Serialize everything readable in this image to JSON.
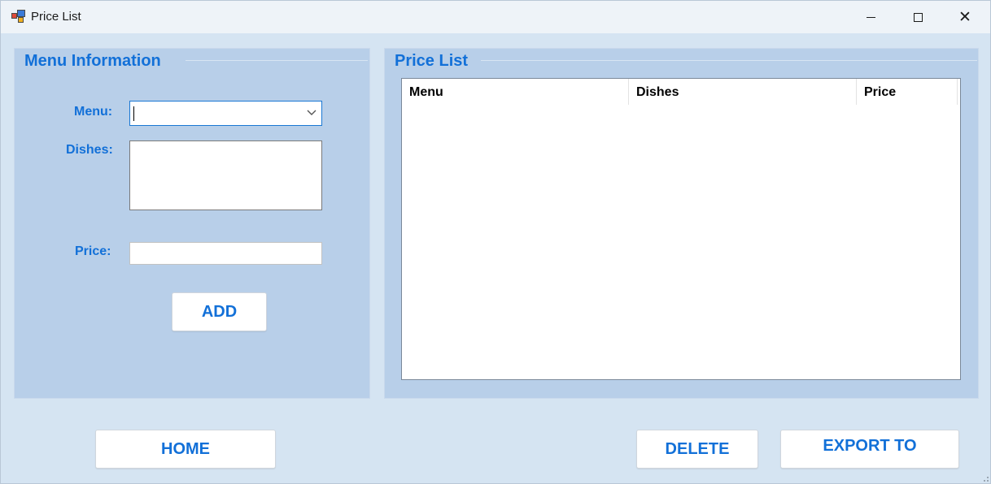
{
  "window": {
    "title": "Price List",
    "controls": {
      "minimize": "minimize",
      "maximize": "maximize",
      "close": "✕"
    }
  },
  "menu_info": {
    "group_title": "Menu Information",
    "menu_label": "Menu:",
    "menu_value": "",
    "dishes_label": "Dishes:",
    "dishes_value": "",
    "price_label": "Price:",
    "price_value": "",
    "add_button": "ADD"
  },
  "price_list": {
    "group_title": "Price List",
    "columns": [
      "Menu",
      "Dishes",
      "Price"
    ],
    "rows": []
  },
  "footer": {
    "home_button": "HOME",
    "delete_button": "DELETE",
    "export_button": "EXPORT TO"
  },
  "colors": {
    "accent_text": "#1270d8",
    "window_bg": "#d5e4f2",
    "group_bg": "#b8cfe9"
  },
  "icons": [
    "app-icon",
    "chevron-down-icon",
    "minimize-icon",
    "maximize-icon",
    "close-icon"
  ]
}
